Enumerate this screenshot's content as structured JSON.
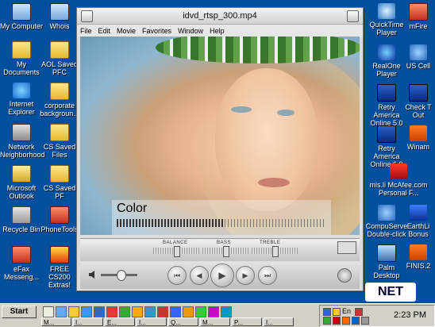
{
  "desktop": {
    "left_icons": [
      {
        "label": "My Computer",
        "icon": "computer-icon"
      },
      {
        "label": "Whois",
        "icon": "whois-icon"
      },
      {
        "label": "My Documents",
        "icon": "folder-icon"
      },
      {
        "label": "AOL Saved PFC",
        "icon": "folder-icon"
      },
      {
        "label": "Internet Explorer",
        "icon": "internet-explorer-icon"
      },
      {
        "label": "corporate backgroun...",
        "icon": "folder-icon"
      },
      {
        "label": "Network Neighborhood",
        "icon": "network-icon"
      },
      {
        "label": "CS Saved Files",
        "icon": "folder-icon"
      },
      {
        "label": "Microsoft Outlook",
        "icon": "outlook-icon"
      },
      {
        "label": "CS Saved PF",
        "icon": "folder-icon"
      },
      {
        "label": "Recycle Bin",
        "icon": "recycle-bin-icon"
      },
      {
        "label": "PhoneTools",
        "icon": "phonetools-icon"
      },
      {
        "label": "eFax Messeng...",
        "icon": "efax-icon"
      },
      {
        "label": "FREE CS200 Extras!",
        "icon": "gift-icon"
      }
    ],
    "right_icons": [
      {
        "label": "QuickTime Player",
        "icon": "quicktime-icon"
      },
      {
        "label": "mFire",
        "icon": "mfire-icon"
      },
      {
        "label": "RealOne Player",
        "icon": "realone-icon"
      },
      {
        "label": "US Cell",
        "icon": "us-cell-icon"
      },
      {
        "label": "Retry America Online 5.0",
        "icon": "aol-icon"
      },
      {
        "label": "Check T Out",
        "icon": "check-icon"
      },
      {
        "label": "Retry America Online 6.0",
        "icon": "aol-icon"
      },
      {
        "label": "Winam",
        "icon": "winamp-icon"
      },
      {
        "label": "mis.li McAfee.com Personal F...",
        "icon": "mcafee-icon"
      },
      {
        "label": "CompuServe Double-click",
        "icon": "compuserve-icon"
      },
      {
        "label": "EarthLi Bonus",
        "icon": "earthlink-icon"
      },
      {
        "label": "Palm Desktop",
        "icon": "palm-icon"
      },
      {
        "label": "FINIS.2",
        "icon": "finis-icon"
      }
    ],
    "brand": "NET"
  },
  "player": {
    "title": "idvd_rtsp_300.mp4",
    "menu": [
      "File",
      "Edit",
      "Movie",
      "Favorites",
      "Window",
      "Help"
    ],
    "overlay_label": "Color",
    "overlay_level": 0.52,
    "eq_labels": {
      "balance": "BALANCE",
      "bass": "BASS",
      "treble": "TREBLE"
    },
    "eq_levels": {
      "balance": 0.5,
      "bass": 0.5,
      "treble": 0.5
    },
    "volume_level": 0.55,
    "buttons": {
      "rewind": "⏮",
      "back": "◀",
      "play": "▶",
      "forward": "▶",
      "end": "⏭"
    }
  },
  "taskbar": {
    "start_label": "Start",
    "tasks": [
      "M...",
      "I...",
      "E...",
      "I...",
      "Q...",
      "M...",
      "P...",
      "I..."
    ],
    "tray_label": "En",
    "clock": "2:23 PM"
  }
}
